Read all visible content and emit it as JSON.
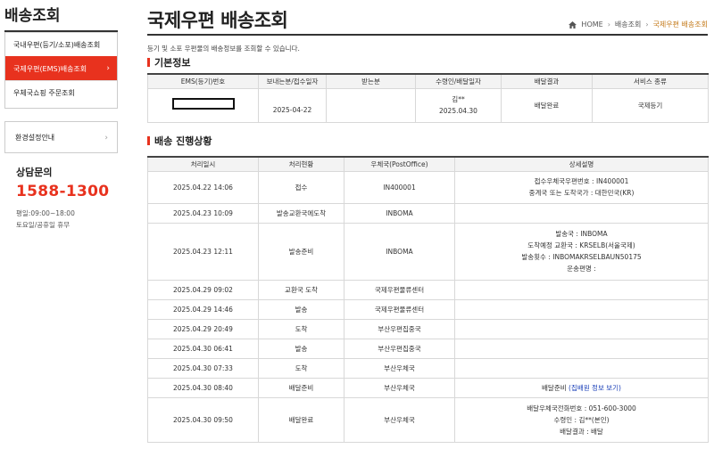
{
  "sidebar": {
    "title": "배송조회",
    "menu": [
      {
        "label": "국내우편(등기/소포)배송조회"
      },
      {
        "label": "국제우편(EMS)배송조회",
        "chev": "›"
      },
      {
        "label": "우체국쇼핑 주문조회"
      }
    ],
    "env": {
      "label": "환경설정안내",
      "chev": "›"
    },
    "consult": {
      "label": "상담문의",
      "phone": "1588-1300",
      "hours_weekday": "평일:09:00~18:00",
      "hours_weekend": "토요일/공휴일 휴무"
    }
  },
  "header": {
    "title": "국제우편 배송조회",
    "breadcrumb": [
      "HOME",
      "배송조회",
      "국제우편 배송조회"
    ],
    "breadcrumb_sep": "›",
    "description": "등기 및 소포 우편물의 배송정보를 조회할 수 있습니다."
  },
  "basic": {
    "title": "기본정보",
    "headers": [
      "EMS(등기)번호",
      "보내는분/접수일자",
      "받는분",
      "수령인/배달일자",
      "배달결과",
      "서비스 종류"
    ],
    "row": {
      "sender_date": "2025-04-22",
      "receiver": "",
      "recipient": "김**",
      "delivery_date": "2025.04.30",
      "result": "배달완료",
      "service": "국제등기"
    }
  },
  "progress": {
    "title": "배송 진행상황",
    "headers": [
      "처리일시",
      "처리현황",
      "우체국(PostOffice)",
      "상세설명"
    ],
    "rows": [
      {
        "datetime": "2025.04.22 14:06",
        "status": "접수",
        "office": "IN400001",
        "detail": [
          "접수우체국우편번호 : IN400001",
          "중계국 또는 도착국가 : 대한민국(KR)"
        ]
      },
      {
        "datetime": "2025.04.23 10:09",
        "status": "발송교환국에도착",
        "office": "INBOMA",
        "detail": []
      },
      {
        "datetime": "2025.04.23 12:11",
        "status": "발송준비",
        "office": "INBOMA",
        "detail": [
          "발송국 : INBOMA",
          "도착예정 교환국 : KRSELB(서울국제)",
          "발송횟수 : INBOMAKRSELBAUN50175",
          "운송편명 :"
        ]
      },
      {
        "datetime": "2025.04.29 09:02",
        "status": "교환국 도착",
        "office": "국제우편물류센터",
        "detail": []
      },
      {
        "datetime": "2025.04.29 14:46",
        "status": "발송",
        "office": "국제우편물류센터",
        "detail": []
      },
      {
        "datetime": "2025.04.29 20:49",
        "status": "도착",
        "office": "부산우편집중국",
        "detail": []
      },
      {
        "datetime": "2025.04.30 06:41",
        "status": "발송",
        "office": "부산우편집중국",
        "detail": []
      },
      {
        "datetime": "2025.04.30 07:33",
        "status": "도착",
        "office": "부산우체국",
        "detail": []
      },
      {
        "datetime": "2025.04.30 08:40",
        "status": "배달준비",
        "office": "부산우체국",
        "detail": [
          "배달준비"
        ],
        "detail_link": "(집배원 정보 보기)"
      },
      {
        "datetime": "2025.04.30 09:50",
        "status": "배달완료",
        "office": "부산우체국",
        "detail": [
          "배달우체국전화번호 : 051-600-3000",
          "수령인 : 김**(본인)",
          "배달결과 : 배달"
        ]
      }
    ]
  }
}
